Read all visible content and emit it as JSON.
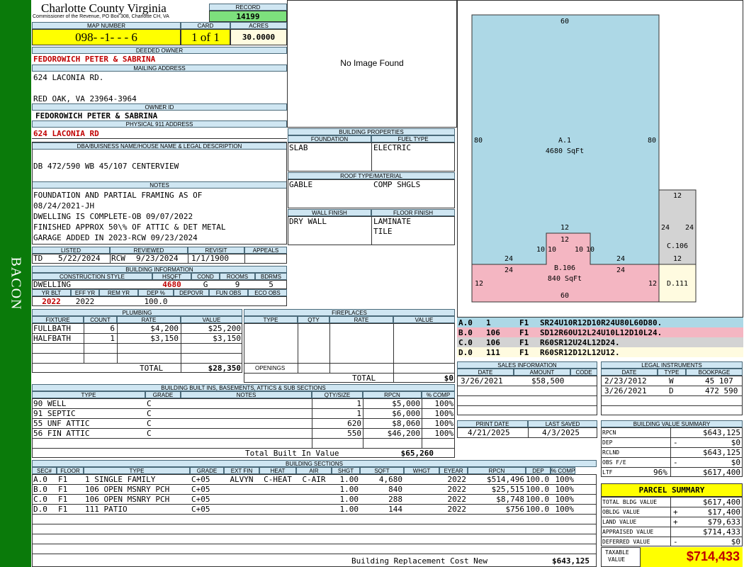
{
  "side_label": "BACON",
  "county": "Charlotte County Virginia",
  "commissioner": "Commissioner of the Revenue, PO Box 308, Charlotte CH, VA",
  "record": {
    "label": "RECORD",
    "value": "14199"
  },
  "map": {
    "label": "MAP NUMBER",
    "value": "098- -1- - - 6"
  },
  "card": {
    "label": "CARD",
    "value": "1 of 1"
  },
  "acres": {
    "label": "ACRES",
    "value": "30.0000"
  },
  "deeded_owner": {
    "label": "DEEDED OWNER",
    "value": "FEDOROWICH PETER & SABRINA"
  },
  "mailing": {
    "label": "MAILING ADDRESS",
    "line1": "624 LACONIA RD.",
    "line2": "RED OAK, VA 23964-3964"
  },
  "owner_id": {
    "label": "OWNER ID",
    "value": "FEDOROWICH PETER & SABRINA"
  },
  "physical": {
    "label": "PHYSICAL 911 ADDRESS",
    "value": "624 LACONIA RD"
  },
  "dba": {
    "label": "DBA/BUISNESS NAME/HOUSE NAME & LEGAL DESCRIPTION",
    "value": "DB 472/590 WB 45/107 CENTERVIEW"
  },
  "notes": {
    "label": "NOTES",
    "lines": [
      "FOUNDATION AND PARTIAL FRAMING AS OF",
      "08/24/2021-JH",
      "DWELLING IS COMPLETE-OB 09/07/2022",
      "FINISHED APPROX 50\\% OF ATTIC & DET METAL",
      "GARAGE ADDED IN 2023-RCW 09/23/2024"
    ]
  },
  "listed": {
    "listed_label": "LISTED",
    "reviewed_label": "REVIEWED",
    "revisit_label": "REVISIT",
    "appeals_label": "APPEALS",
    "by": "TD",
    "listed": "5/22/2024",
    "rev_by": "RCW",
    "reviewed": "9/23/2024",
    "revisit": "1/1/1900",
    "appeals": ""
  },
  "building_info": {
    "label": "BUILDING INFORMATION",
    "h_style": "CONSTRUCTION STYLE",
    "h_sqft": "HSQFT",
    "h_cond": "COND",
    "h_rooms": "ROOMS",
    "h_bdrms": "BDRMS",
    "style": "DWELLING",
    "sqft": "4680",
    "cond": "G",
    "rooms": "9",
    "bdrms": "5",
    "h_yrblt": "YR BLT",
    "h_effyr": "EFF YR",
    "h_remyr": "REM YR",
    "h_dep": "DEP %",
    "h_depovr": "DEPOVR",
    "h_funobs": "FUN OBS",
    "h_ecoobs": "ECO OBS",
    "yrblt": "2022",
    "effyr": "2022",
    "remyr": "",
    "dep": "100.0"
  },
  "no_image": "No Image Found",
  "building_props": {
    "label": "BUILDING PROPERTIES",
    "foundation_label": "FOUNDATION",
    "fuel_label": "FUEL TYPE",
    "foundation": "SLAB",
    "fuel": "ELECTRIC",
    "roof_label": "ROOF TYPE/MATERIAL",
    "roof1": "GABLE",
    "roof2": "COMP SHGLS",
    "wall_label": "WALL FINISH",
    "floor_label": "FLOOR FINISH",
    "wall": "DRY WALL",
    "floor1": "LAMINATE",
    "floor2": "TILE"
  },
  "sketch": {
    "colors": {
      "A": "#add8e6",
      "B": "#f4b6c2",
      "C": "#d3d3d3",
      "D": "#fffbe0"
    },
    "labels": {
      "top": "60",
      "left": "80",
      "right": "80",
      "a_name": "A.1",
      "a_area": "4680 SqFt",
      "b_name": "B.106",
      "b_area": "840 SqFt",
      "b_bottom": "60",
      "b_left": "12",
      "b_right": "12",
      "b_top_l": "24",
      "b_top_r": "24",
      "b_tl": "24",
      "b_tr": "24",
      "notch_top": "12",
      "notch_top2": "12",
      "notch_l1": "10",
      "notch_l2": "10",
      "notch_r1": "10",
      "notch_r2": "10",
      "c_top": "12",
      "c_left": "24",
      "c_right": "24",
      "c_name": "C.106",
      "c_bottom": "12",
      "d_name": "D.111"
    },
    "legend": [
      {
        "id": "A.0",
        "a": "1",
        "f": "F1",
        "code": "SR24U10R12D10R24U80L60D80."
      },
      {
        "id": "B.0",
        "a": "106",
        "f": "F1",
        "code": "SD12R60U12L24U10L12D10L24."
      },
      {
        "id": "C.0",
        "a": "106",
        "f": "F1",
        "code": "R60SR12U24L12D24."
      },
      {
        "id": "D.0",
        "a": "111",
        "f": "F1",
        "code": "R60SR12D12L12U12."
      }
    ]
  },
  "plumbing": {
    "label": "PLUMBING",
    "h_fixture": "FIXTURE",
    "h_count": "COUNT",
    "h_rate": "RATE",
    "h_value": "VALUE",
    "rows": [
      {
        "fixture": "FULLBATH",
        "count": "6",
        "rate": "$4,200",
        "value": "$25,200"
      },
      {
        "fixture": "HALFBATH",
        "count": "1",
        "rate": "$3,150",
        "value": "$3,150"
      }
    ],
    "total_label": "TOTAL",
    "total": "$28,350"
  },
  "fireplaces": {
    "label": "FIREPLACES",
    "h_type": "TYPE",
    "h_qty": "QTY",
    "h_rate": "RATE",
    "h_value": "VALUE",
    "openings": "OPENINGS",
    "total_label": "TOTAL",
    "total": "$0"
  },
  "sales": {
    "label": "SALES INFORMATION",
    "h_date": "DATE",
    "h_amount": "AMOUNT",
    "h_code": "CODE",
    "rows": [
      {
        "date": "3/26/2021",
        "amount": "$58,500",
        "code": ""
      }
    ]
  },
  "legal": {
    "label": "LEGAL INSTRUMENTS",
    "h_date": "DATE",
    "h_type": "TYPE",
    "h_book": "BOOKPAGE",
    "rows": [
      {
        "date": "2/23/2012",
        "type": "W",
        "book": "45 107"
      },
      {
        "date": "3/26/2021",
        "type": "D",
        "book": "472 590"
      }
    ]
  },
  "builtins": {
    "label": "BUILDING BUILT INS, BASEMENTS, ATTICS & SUB SECTIONS",
    "h_type": "TYPE",
    "h_grade": "GRADE",
    "h_notes": "NOTES",
    "h_qty": "QTY/SIZE",
    "h_rpcn": "RPCN",
    "h_comp": "% COMP",
    "rows": [
      {
        "type": "90 WELL",
        "grade": "C",
        "notes": "",
        "qty": "1",
        "rpcn": "$5,000",
        "comp": "100%"
      },
      {
        "type": "91 SEPTIC",
        "grade": "C",
        "notes": "",
        "qty": "1",
        "rpcn": "$6,000",
        "comp": "100%"
      },
      {
        "type": "55 UNF ATTIC",
        "grade": "C",
        "notes": "",
        "qty": "620",
        "rpcn": "$8,060",
        "comp": "100%"
      },
      {
        "type": "56 FIN ATTIC",
        "grade": "C",
        "notes": "",
        "qty": "550",
        "rpcn": "$46,200",
        "comp": "100%"
      }
    ],
    "total_label": "Total Built In Value",
    "total": "$65,260"
  },
  "print": {
    "print_label": "PRINT DATE",
    "saved_label": "LAST SAVED",
    "print": "4/21/2025",
    "saved": "4/3/2025"
  },
  "bvs": {
    "label": "BUILDING VALUE SUMMARY",
    "rows": [
      {
        "k": "RPCN",
        "s": "",
        "v": "$643,125"
      },
      {
        "k": "DEP",
        "s": "-",
        "v": "$0"
      },
      {
        "k": "RCLND",
        "s": "",
        "v": "$643,125"
      },
      {
        "k": "OBS F/E",
        "s": "-",
        "v": "$0"
      },
      {
        "k": "LTF",
        "s": "96%",
        "v": "$617,400"
      }
    ]
  },
  "sections": {
    "label": "BUILDING SECTIONS",
    "h": [
      "SEC#",
      "FLOOR",
      "TYPE",
      "GRADE",
      "EXT FIN",
      "HEAT",
      "AIR",
      "SHGT",
      "SQFT",
      "WHGT",
      "EYEAR",
      "RPCN",
      "DEP",
      "% COMP"
    ],
    "rows": [
      [
        "A.0",
        "F1",
        "1 SINGLE FAMILY",
        "C+05",
        "ALVYN",
        "C-HEAT",
        "C-AIR",
        "1.00",
        "4,680",
        "",
        "2022",
        "$514,496",
        "100.0",
        "100%"
      ],
      [
        "B.0",
        "F1",
        "106 OPEN MSNRY PCH",
        "C+05",
        "",
        "",
        "",
        "1.00",
        "840",
        "",
        "2022",
        "$25,515",
        "100.0",
        "100%"
      ],
      [
        "C.0",
        "F1",
        "106 OPEN MSNRY PCH",
        "C+05",
        "",
        "",
        "",
        "1.00",
        "288",
        "",
        "2022",
        "$8,748",
        "100.0",
        "100%"
      ],
      [
        "D.0",
        "F1",
        "111 PATIO",
        "C+05",
        "",
        "",
        "",
        "1.00",
        "144",
        "",
        "2022",
        "$756",
        "100.0",
        "100%"
      ]
    ],
    "total_label": "Building Replacement Cost New",
    "total": "$643,125"
  },
  "parcel": {
    "label": "PARCEL SUMMARY",
    "rows": [
      {
        "k": "TOTAL BLDG VALUE",
        "s": "",
        "v": "$617,400"
      },
      {
        "k": "OBLDG VALUE",
        "s": "+",
        "v": "$17,400"
      },
      {
        "k": "LAND VALUE",
        "s": "+",
        "v": "$79,633"
      },
      {
        "k": "APPRAISED VALUE",
        "s": "",
        "v": "$714,433"
      },
      {
        "k": "DEFERRED VALUE",
        "s": "-",
        "v": "$0"
      }
    ],
    "taxable_label1": "TAXABLE",
    "taxable_label2": "VALUE",
    "taxable": "$714,433"
  }
}
